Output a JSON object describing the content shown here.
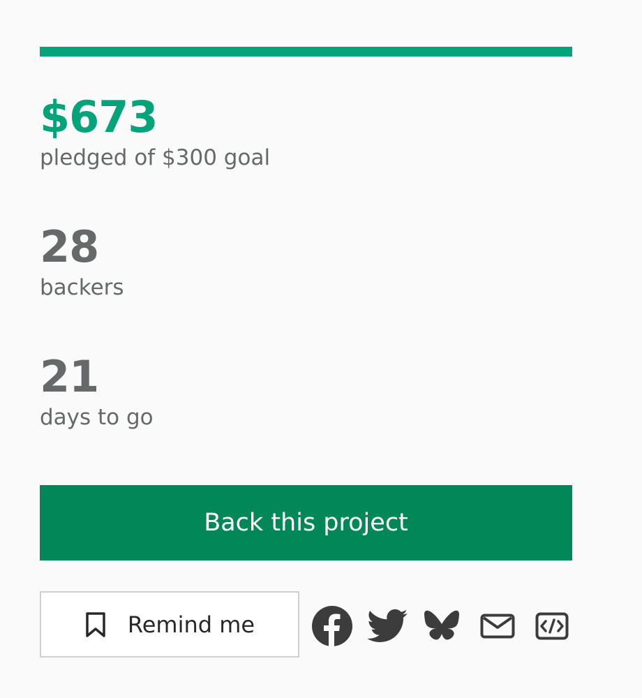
{
  "campaign": {
    "progress_fraction": 1.0,
    "pledged_amount": "$673",
    "pledged_label": "pledged of $300 goal",
    "backers_count": "28",
    "backers_label": "backers",
    "days_left": "21",
    "days_label": "days to go"
  },
  "actions": {
    "back_label": "Back this project",
    "remind_label": "Remind me"
  },
  "share_icons": [
    "facebook-icon",
    "twitter-icon",
    "bluesky-icon",
    "email-icon",
    "embed-icon"
  ],
  "colors": {
    "accent": "#05a37a",
    "button": "#028858",
    "text_muted": "#656969",
    "icon": "#3c3c3c"
  }
}
